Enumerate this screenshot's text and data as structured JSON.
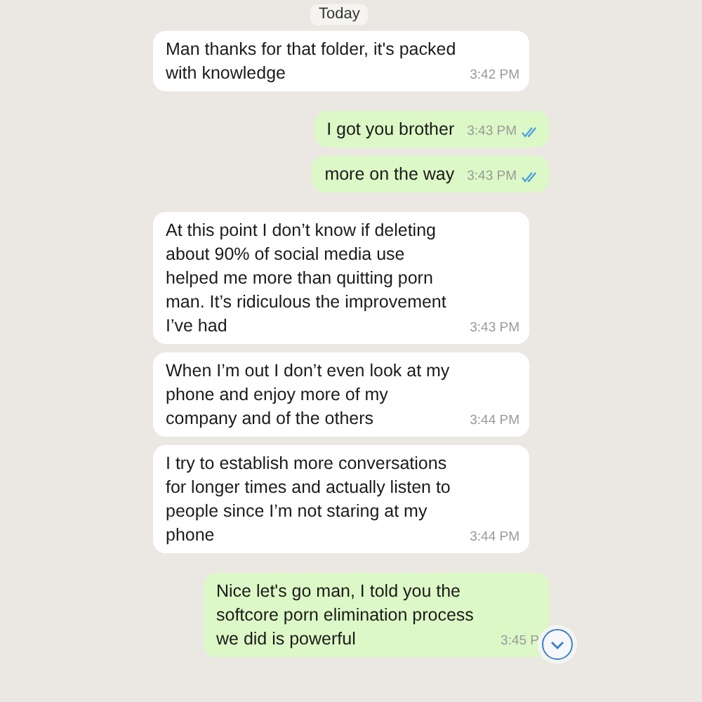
{
  "date_badge": "Today",
  "messages": [
    {
      "kind": "received",
      "text": "Man thanks for that folder, it's packed with knowledge",
      "time": "3:42 PM"
    },
    {
      "kind": "sent",
      "text": "I got you brother",
      "time": "3:43 PM",
      "read": true
    },
    {
      "kind": "sent",
      "text": "more on the way",
      "time": "3:43 PM",
      "read": true
    },
    {
      "kind": "received",
      "text": "At this point I don’t know if deleting  about 90% of social media use helped me more than quitting porn man. It’s ridiculous the improvement I’ve had",
      "time": "3:43 PM"
    },
    {
      "kind": "received",
      "text": "When I’m out I don’t even look at my phone and enjoy more of my company and of the others",
      "time": "3:44 PM"
    },
    {
      "kind": "received",
      "text": "I try to establish more conversations for longer times and actually listen to people since I’m not staring at my phone",
      "time": "3:44 PM"
    },
    {
      "kind": "sent",
      "text": "Nice let's go man, I told you the softcore porn elimination process we did is powerful",
      "time": "3:45 P"
    }
  ]
}
